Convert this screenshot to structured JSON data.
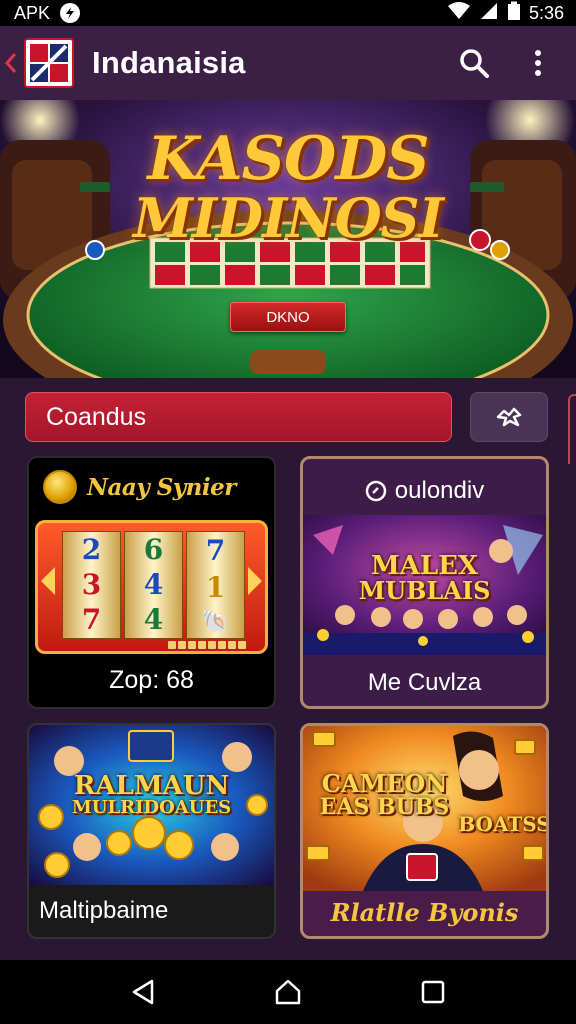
{
  "status_bar": {
    "left_label": "APK",
    "time": "5:36"
  },
  "app_bar": {
    "title": "Indanaisia"
  },
  "hero": {
    "title_line1": "KASODS",
    "title_line2": "MIDINOSI",
    "button_label": "DKNO"
  },
  "search": {
    "value": "Coandus"
  },
  "cards": [
    {
      "header": "Naay Synier",
      "label": "Zop: 68",
      "reels": [
        [
          "2",
          "3",
          "7"
        ],
        [
          "6",
          "4",
          "4"
        ],
        [
          "7",
          "1",
          "🐚"
        ]
      ]
    },
    {
      "header": "oulondiv",
      "label": "Me Cuvlza",
      "art_title_line1": "MALEX",
      "art_title_line2": "MUBLAIS"
    },
    {
      "label": "Maltipbaime",
      "art_title_line1": "RALMAUN",
      "art_title_line2": "MULRIDOAUES"
    },
    {
      "label": "Rlatlle Byonis",
      "art_title_line1": "CAMEON",
      "art_title_line2": "EAS BUBS",
      "art_badge": "BOATSS"
    }
  ]
}
